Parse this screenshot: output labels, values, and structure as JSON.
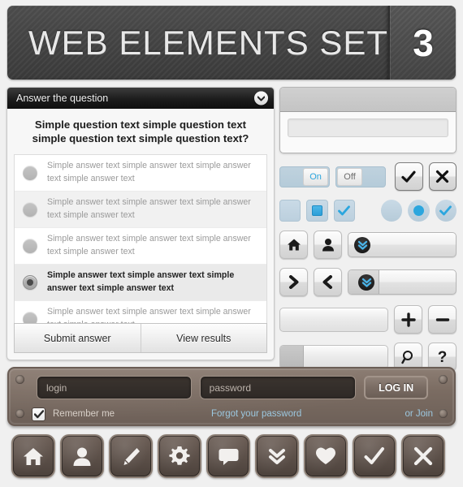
{
  "banner": {
    "title": "WEB ELEMENTS SET",
    "number": "3"
  },
  "question_panel": {
    "header_title": "Answer the question",
    "collapse_icon": "chevron-down-icon",
    "question": "Simple question text simple question text simple question text simple question text?",
    "answers": [
      {
        "text": "Simple answer text simple answer text simple answer text simple answer text",
        "selected": false
      },
      {
        "text": "Simple answer text simple answer text simple answer text simple answer text",
        "selected": false
      },
      {
        "text": "Simple answer text simple answer text simple answer text simple answer text",
        "selected": false
      },
      {
        "text": "Simple answer text simple answer text simple answer text simple answer text",
        "selected": true
      },
      {
        "text": "Simple answer text simple answer text simple answer text simple answer text",
        "selected": false
      }
    ],
    "submit_label": "Submit answer",
    "results_label": "View results"
  },
  "widgets": {
    "toggle_on_label": "On",
    "toggle_off_label": "Off",
    "check_button_icon": "check-icon",
    "close_button_icon": "close-icon",
    "checkbox_icons": [
      "checkbox-empty-icon",
      "checkbox-square-icon",
      "checkbox-check-icon"
    ],
    "radio_icons": [
      "radio-empty-icon",
      "radio-filled-icon",
      "radio-check-icon"
    ],
    "home_icon": "home-icon",
    "user_icon": "user-icon",
    "dropdown_icon": "double-chevron-down-icon",
    "next_icon": "chevron-right-icon",
    "prev_icon": "chevron-left-icon",
    "plus_icon": "plus-icon",
    "minus_icon": "minus-icon",
    "search_icon": "search-icon",
    "help_icon": "question-mark-icon",
    "progress_fill_percent": 22
  },
  "login": {
    "login_placeholder": "login",
    "password_placeholder": "password",
    "login_button_label": "LOG IN",
    "remember_label": "Remember me",
    "forgot_link": "Forgot your password",
    "join_link": "or Join",
    "remember_checked": true
  },
  "icon_bar": [
    {
      "name": "home-icon"
    },
    {
      "name": "user-icon"
    },
    {
      "name": "pencil-icon"
    },
    {
      "name": "gear-icon"
    },
    {
      "name": "chat-bubble-icon"
    },
    {
      "name": "double-chevron-down-icon"
    },
    {
      "name": "heart-icon"
    },
    {
      "name": "check-icon"
    },
    {
      "name": "close-icon"
    }
  ],
  "colors": {
    "accent_blue": "#2ba6de",
    "banner_dark": "#444444",
    "panel_brown": "#7b6c62",
    "link_blue": "#9cc8e0"
  }
}
